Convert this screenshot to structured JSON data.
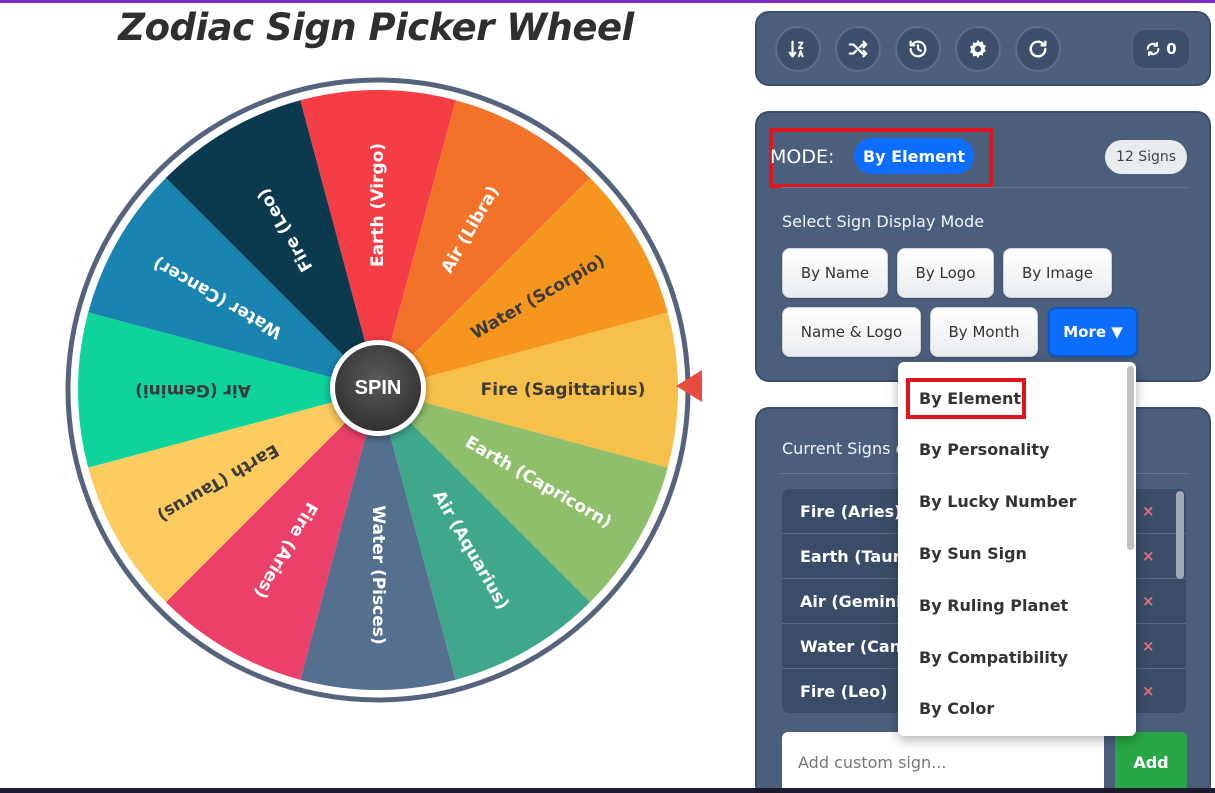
{
  "title": "Zodiac Sign Picker Wheel",
  "spin_label": "SPIN",
  "wheel": {
    "segments": [
      {
        "label": "Fire (Sagittarius)",
        "color": "#f7c04a",
        "text_color": "#3b3b3b"
      },
      {
        "label": "Earth (Capricorn)",
        "color": "#8fbf6a",
        "text_color": "#ffffff"
      },
      {
        "label": "Air (Aquarius)",
        "color": "#3fa88c",
        "text_color": "#ffffff"
      },
      {
        "label": "Water (Pisces)",
        "color": "#55708e",
        "text_color": "#ffffff"
      },
      {
        "label": "Fire (Aries)",
        "color": "#ea4069",
        "text_color": "#ffffff"
      },
      {
        "label": "Earth (Taurus)",
        "color": "#fccc60",
        "text_color": "#3b3b3b"
      },
      {
        "label": "Air (Gemini)",
        "color": "#0ed39b",
        "text_color": "#3b3b3b"
      },
      {
        "label": "Water (Cancer)",
        "color": "#1a84b0",
        "text_color": "#ffffff"
      },
      {
        "label": "Fire (Leo)",
        "color": "#0b394d",
        "text_color": "#ffffff"
      },
      {
        "label": "Earth (Virgo)",
        "color": "#f53d45",
        "text_color": "#ffffff"
      },
      {
        "label": "Air (Libra)",
        "color": "#f2722a",
        "text_color": "#ffffff"
      },
      {
        "label": "Water (Scorpio)",
        "color": "#f6961f",
        "text_color": "#3b3b3b"
      }
    ]
  },
  "toolbar": {
    "tools": [
      {
        "icon": "sort-icon"
      },
      {
        "icon": "shuffle-icon"
      },
      {
        "icon": "history-icon"
      },
      {
        "icon": "gear-icon"
      },
      {
        "icon": "redo-icon"
      }
    ],
    "counter_value": "0"
  },
  "mode": {
    "label": "MODE:",
    "value": "By Element",
    "count": "12 Signs",
    "section_label": "Select Sign Display Mode",
    "buttons": [
      "By Name",
      "By Logo",
      "By Image",
      "Name & Logo",
      "By Month",
      "More ▼"
    ]
  },
  "current": {
    "label": "Current Signs o",
    "items": [
      {
        "label": "Fire (Aries)"
      },
      {
        "label": "Earth (Tauru"
      },
      {
        "label": "Air (Gemini)"
      },
      {
        "label": "Water (Canc"
      },
      {
        "label": "Fire (Leo)"
      }
    ],
    "remove_symbol": "×",
    "input_placeholder": "Add custom sign...",
    "add_label": "Add"
  },
  "dropdown": {
    "items": [
      "By Element",
      "By Personality",
      "By Lucky Number",
      "By Sun Sign",
      "By Ruling Planet",
      "By Compatibility",
      "By Color"
    ]
  },
  "colors": {
    "panel": "#4b5f7d",
    "primary": "#0d6efd",
    "success": "#28a745",
    "highlight": "#e0141b"
  }
}
